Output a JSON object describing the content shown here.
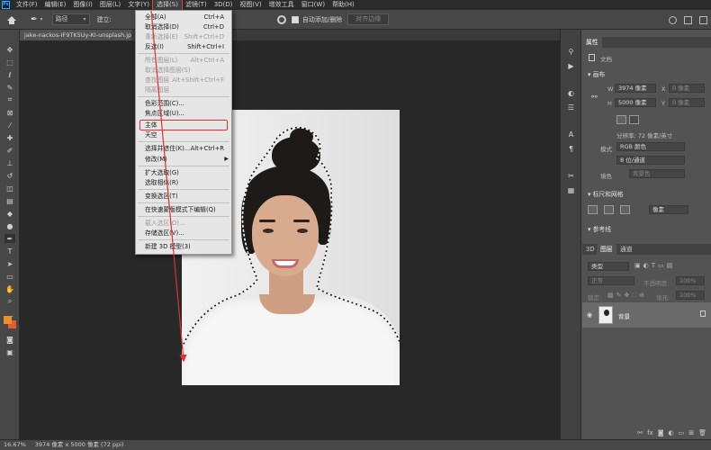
{
  "menubar": {
    "logo": "Ps",
    "items": [
      "文件(F)",
      "编辑(E)",
      "图像(I)",
      "图层(L)",
      "文字(Y)",
      "选择(S)",
      "滤镜(T)",
      "3D(D)",
      "视图(V)",
      "增效工具",
      "窗口(W)",
      "帮助(H)"
    ],
    "active_index": 5
  },
  "options": {
    "path_select": "路径",
    "build_label": "建立:",
    "auto_add_remove": "自动添加/删除",
    "align_edges": "对齐边缘"
  },
  "document": {
    "tab_title": "jake-nackos-IF9TK5Uy-KI-unsplash.jpg @"
  },
  "select_menu": {
    "items": [
      {
        "label": "全部(A)",
        "shortcut": "Ctrl+A",
        "disabled": false
      },
      {
        "label": "取消选择(D)",
        "shortcut": "Ctrl+D",
        "disabled": false
      },
      {
        "label": "重新选择(E)",
        "shortcut": "Shift+Ctrl+D",
        "disabled": true
      },
      {
        "label": "反选(I)",
        "shortcut": "Shift+Ctrl+I",
        "disabled": false
      },
      {
        "label": "所有图层(L)",
        "shortcut": "Alt+Ctrl+A",
        "disabled": true
      },
      {
        "label": "取消选择图层(S)",
        "shortcut": "",
        "disabled": true
      },
      {
        "label": "查找图层",
        "shortcut": "Alt+Shift+Ctrl+F",
        "disabled": true
      },
      {
        "label": "隔离图层",
        "shortcut": "",
        "disabled": true
      },
      {
        "label": "色彩范围(C)...",
        "shortcut": "",
        "disabled": false
      },
      {
        "label": "焦点区域(U)...",
        "shortcut": "",
        "disabled": false
      },
      {
        "label": "主体",
        "shortcut": "",
        "disabled": false
      },
      {
        "label": "天空",
        "shortcut": "",
        "disabled": false
      },
      {
        "label": "选择并遮住(K)...",
        "shortcut": "Alt+Ctrl+R",
        "disabled": false
      },
      {
        "label": "修改(M)",
        "shortcut": "",
        "disabled": false
      },
      {
        "label": "扩大选取(G)",
        "shortcut": "",
        "disabled": false
      },
      {
        "label": "选取相似(R)",
        "shortcut": "",
        "disabled": false
      },
      {
        "label": "变换选区(T)",
        "shortcut": "",
        "disabled": false
      },
      {
        "label": "在快速蒙版模式下编辑(Q)",
        "shortcut": "",
        "disabled": false
      },
      {
        "label": "载入选区(O)...",
        "shortcut": "",
        "disabled": true
      },
      {
        "label": "存储选区(V)...",
        "shortcut": "",
        "disabled": false
      },
      {
        "label": "新建 3D 模型(3)",
        "shortcut": "",
        "disabled": false
      }
    ],
    "highlighted_label": "主体"
  },
  "status": {
    "zoom": "16.67%",
    "dimensions": "3974 像素 x 5000 像素 (72 ppi)"
  },
  "properties": {
    "tab": "属性",
    "doc_label": "文档",
    "canvas_section": "画布",
    "w_label": "W",
    "w_value": "3974 像素",
    "x_label": "X",
    "x_placeholder": "0 像素",
    "h_label": "H",
    "h_value": "5000 像素",
    "y_label": "Y",
    "y_placeholder": "0 像素",
    "resolution": "分辨率: 72 像素/英寸",
    "mode_label": "模式",
    "mode_value": "RGB 颜色",
    "depth_value": "8 位/通道",
    "fill_label": "填色",
    "fill_value": "背景色",
    "rulers_section": "标尺和网格",
    "ruler_unit": "像素",
    "guides_section": "参考线"
  },
  "layers": {
    "tabs": [
      "3D",
      "图层",
      "通道"
    ],
    "active_tab": "图层",
    "kind_filter": "类型",
    "blend_mode": "正常",
    "opacity_label": "不透明度:",
    "opacity_value": "100%",
    "lock_label": "锁定:",
    "fill_label": "填充:",
    "fill_value": "100%",
    "layer_name": "背景"
  },
  "colors": {
    "foreground": "#e8912b",
    "background": "#e35c2d",
    "highlight": "#e03030"
  }
}
